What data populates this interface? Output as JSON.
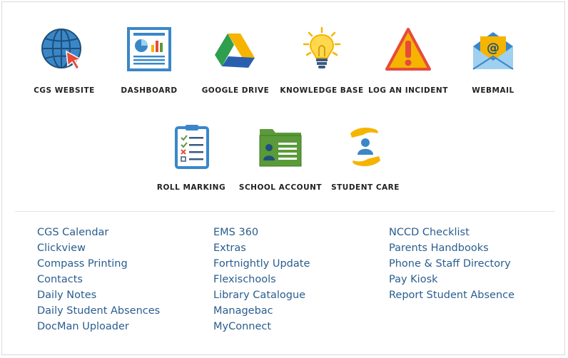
{
  "tiles_row1": [
    {
      "label": "CGS WEBSITE",
      "icon": "globe-cursor-icon"
    },
    {
      "label": "DASHBOARD",
      "icon": "dashboard-chart-icon"
    },
    {
      "label": "GOOGLE DRIVE",
      "icon": "google-drive-icon"
    },
    {
      "label": "KNOWLEDGE BASE",
      "icon": "lightbulb-icon"
    },
    {
      "label": "LOG AN INCIDENT",
      "icon": "warning-icon"
    },
    {
      "label": "WEBMAIL",
      "icon": "mail-icon"
    }
  ],
  "tiles_row2": [
    {
      "label": "ROLL MARKING",
      "icon": "clipboard-checklist-icon"
    },
    {
      "label": "SCHOOL ACCOUNT",
      "icon": "id-folder-icon"
    },
    {
      "label": "STUDENT CARE",
      "icon": "caring-hands-icon"
    }
  ],
  "links": {
    "col1": [
      "CGS Calendar",
      "Clickview",
      "Compass Printing",
      "Contacts",
      "Daily Notes",
      "Daily Student Absences",
      "DocMan Uploader"
    ],
    "col2": [
      "EMS 360",
      "Extras",
      "Fortnightly Update",
      "Flexischools",
      "Library Catalogue",
      "Managebac",
      "MyConnect"
    ],
    "col3": [
      "NCCD Checklist",
      "Parents Handbooks",
      "Phone & Staff Directory",
      "Pay Kiosk",
      "Report Student Absence"
    ]
  },
  "colors": {
    "link": "#2a5d8f",
    "label": "#222222",
    "blue": "#3a87c8",
    "orange": "#f5b400",
    "red": "#e64b3c",
    "green": "#5a9a3a"
  }
}
